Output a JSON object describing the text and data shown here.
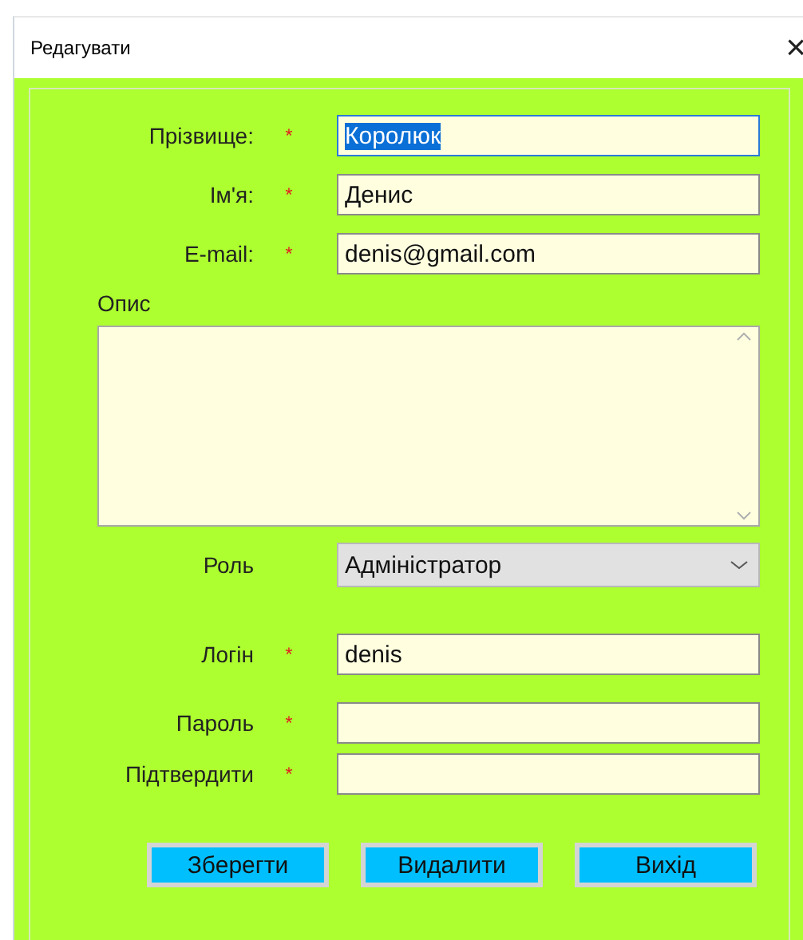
{
  "window": {
    "title": "Редагувати",
    "close": "×"
  },
  "fields": [
    {
      "kind": "text",
      "label": "Прізвище:",
      "required": true,
      "value": "Королюк",
      "value_selected": true
    },
    {
      "kind": "text",
      "label": "Ім'я:",
      "required": true,
      "value": "Денис",
      "value_selected": false
    },
    {
      "kind": "text",
      "label": "E-mail:",
      "required": true,
      "value": "denis@gmail.com",
      "value_selected": false
    },
    {
      "kind": "textarea",
      "label": "Опис"
    },
    {
      "kind": "select",
      "label": "Роль",
      "value": "Адміністратор"
    },
    {
      "kind": "text",
      "label": "Логін",
      "required": true,
      "value": "denis",
      "value_selected": false
    },
    {
      "kind": "text",
      "label": "Пароль",
      "required": true
    },
    {
      "kind": "text",
      "label": "Підтвердити",
      "required": true
    }
  ],
  "required_mark": "*",
  "buttons": [
    "Зберегти",
    "Видалити",
    "Вихід"
  ]
}
